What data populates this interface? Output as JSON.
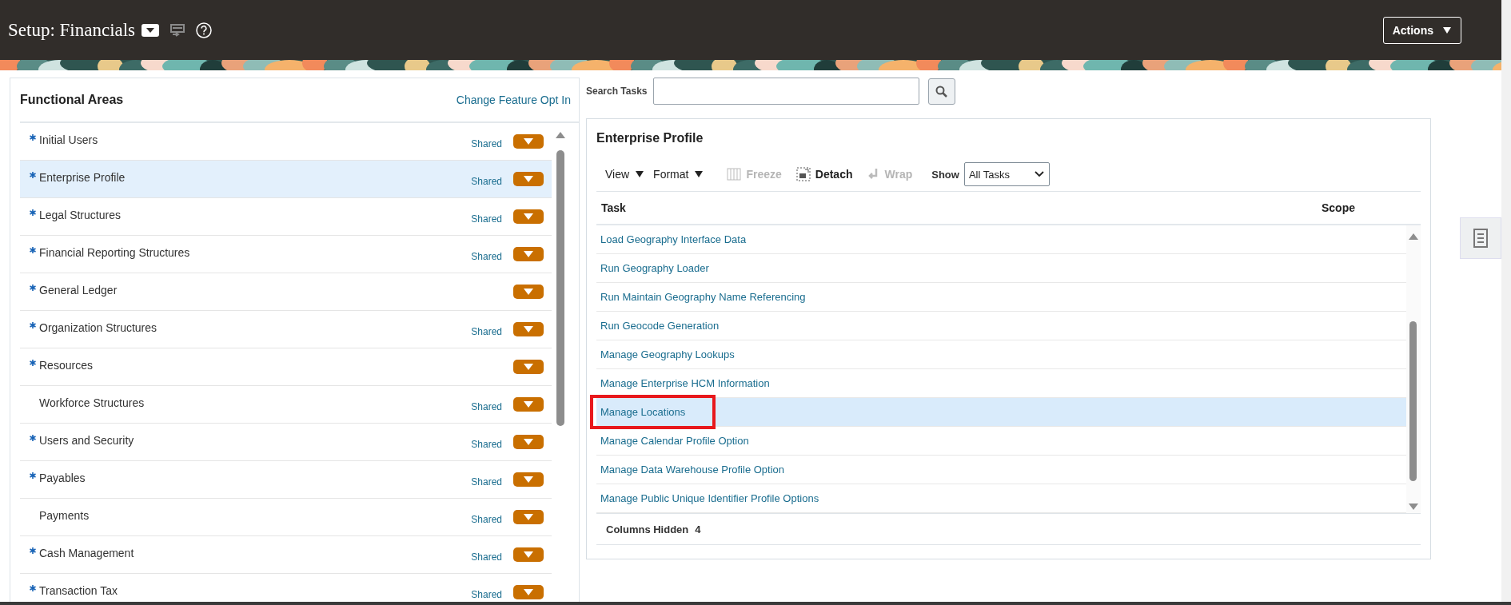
{
  "header": {
    "title": "Setup: Financials",
    "actions_button": "Actions"
  },
  "functional_areas": {
    "title": "Functional Areas",
    "link": "Change Feature Opt In",
    "items": [
      {
        "label": "Initial Users",
        "required": true,
        "scope": "Shared",
        "selected": false
      },
      {
        "label": "Enterprise Profile",
        "required": true,
        "scope": "Shared",
        "selected": true
      },
      {
        "label": "Legal Structures",
        "required": true,
        "scope": "Shared",
        "selected": false
      },
      {
        "label": "Financial Reporting Structures",
        "required": true,
        "scope": "Shared",
        "selected": false
      },
      {
        "label": "General Ledger",
        "required": true,
        "selected": false
      },
      {
        "label": "Organization Structures",
        "required": true,
        "scope": "Shared",
        "selected": false
      },
      {
        "label": "Resources",
        "required": true,
        "selected": false
      },
      {
        "label": "Workforce Structures",
        "required": false,
        "scope": "Shared",
        "selected": false
      },
      {
        "label": "Users and Security",
        "required": true,
        "scope": "Shared",
        "selected": false
      },
      {
        "label": "Payables",
        "required": true,
        "scope": "Shared",
        "selected": false
      },
      {
        "label": "Payments",
        "required": false,
        "scope": "Shared",
        "selected": false
      },
      {
        "label": "Cash Management",
        "required": true,
        "scope": "Shared",
        "selected": false
      },
      {
        "label": "Transaction Tax",
        "required": true,
        "scope": "Shared",
        "selected": false
      }
    ]
  },
  "search": {
    "label": "Search Tasks"
  },
  "task_panel": {
    "title": "Enterprise Profile",
    "toolbar": [
      {
        "label": "View",
        "kind": "menu"
      },
      {
        "label": "Format",
        "kind": "menu"
      },
      {
        "label": "Freeze",
        "kind": "action",
        "disabled": true
      },
      {
        "label": "Detach",
        "kind": "action",
        "disabled": false
      },
      {
        "label": "Wrap",
        "kind": "action",
        "disabled": true
      }
    ],
    "show": {
      "label": "Show",
      "value": "All Tasks"
    },
    "columns": [
      "Task",
      "Scope"
    ],
    "rows": [
      {
        "task": "Load Geography Interface Data",
        "selected": false,
        "outlined": false
      },
      {
        "task": "Run Geography Loader",
        "selected": false,
        "outlined": false
      },
      {
        "task": "Run Maintain Geography Name Referencing",
        "selected": false,
        "outlined": false
      },
      {
        "task": "Run Geocode Generation",
        "selected": false,
        "outlined": false
      },
      {
        "task": "Manage Geography Lookups",
        "selected": false,
        "outlined": false
      },
      {
        "task": "Manage Enterprise HCM Information",
        "selected": false,
        "outlined": false
      },
      {
        "task": "Manage Locations",
        "selected": true,
        "outlined": true
      },
      {
        "task": "Manage Calendar Profile Option",
        "selected": false,
        "outlined": false
      },
      {
        "task": "Manage Data Warehouse Profile Option",
        "selected": false,
        "outlined": false
      },
      {
        "task": "Manage Public Unique Identifier Profile Options",
        "selected": false,
        "outlined": false
      }
    ],
    "footer": {
      "label": "Columns Hidden",
      "value": "4"
    }
  }
}
